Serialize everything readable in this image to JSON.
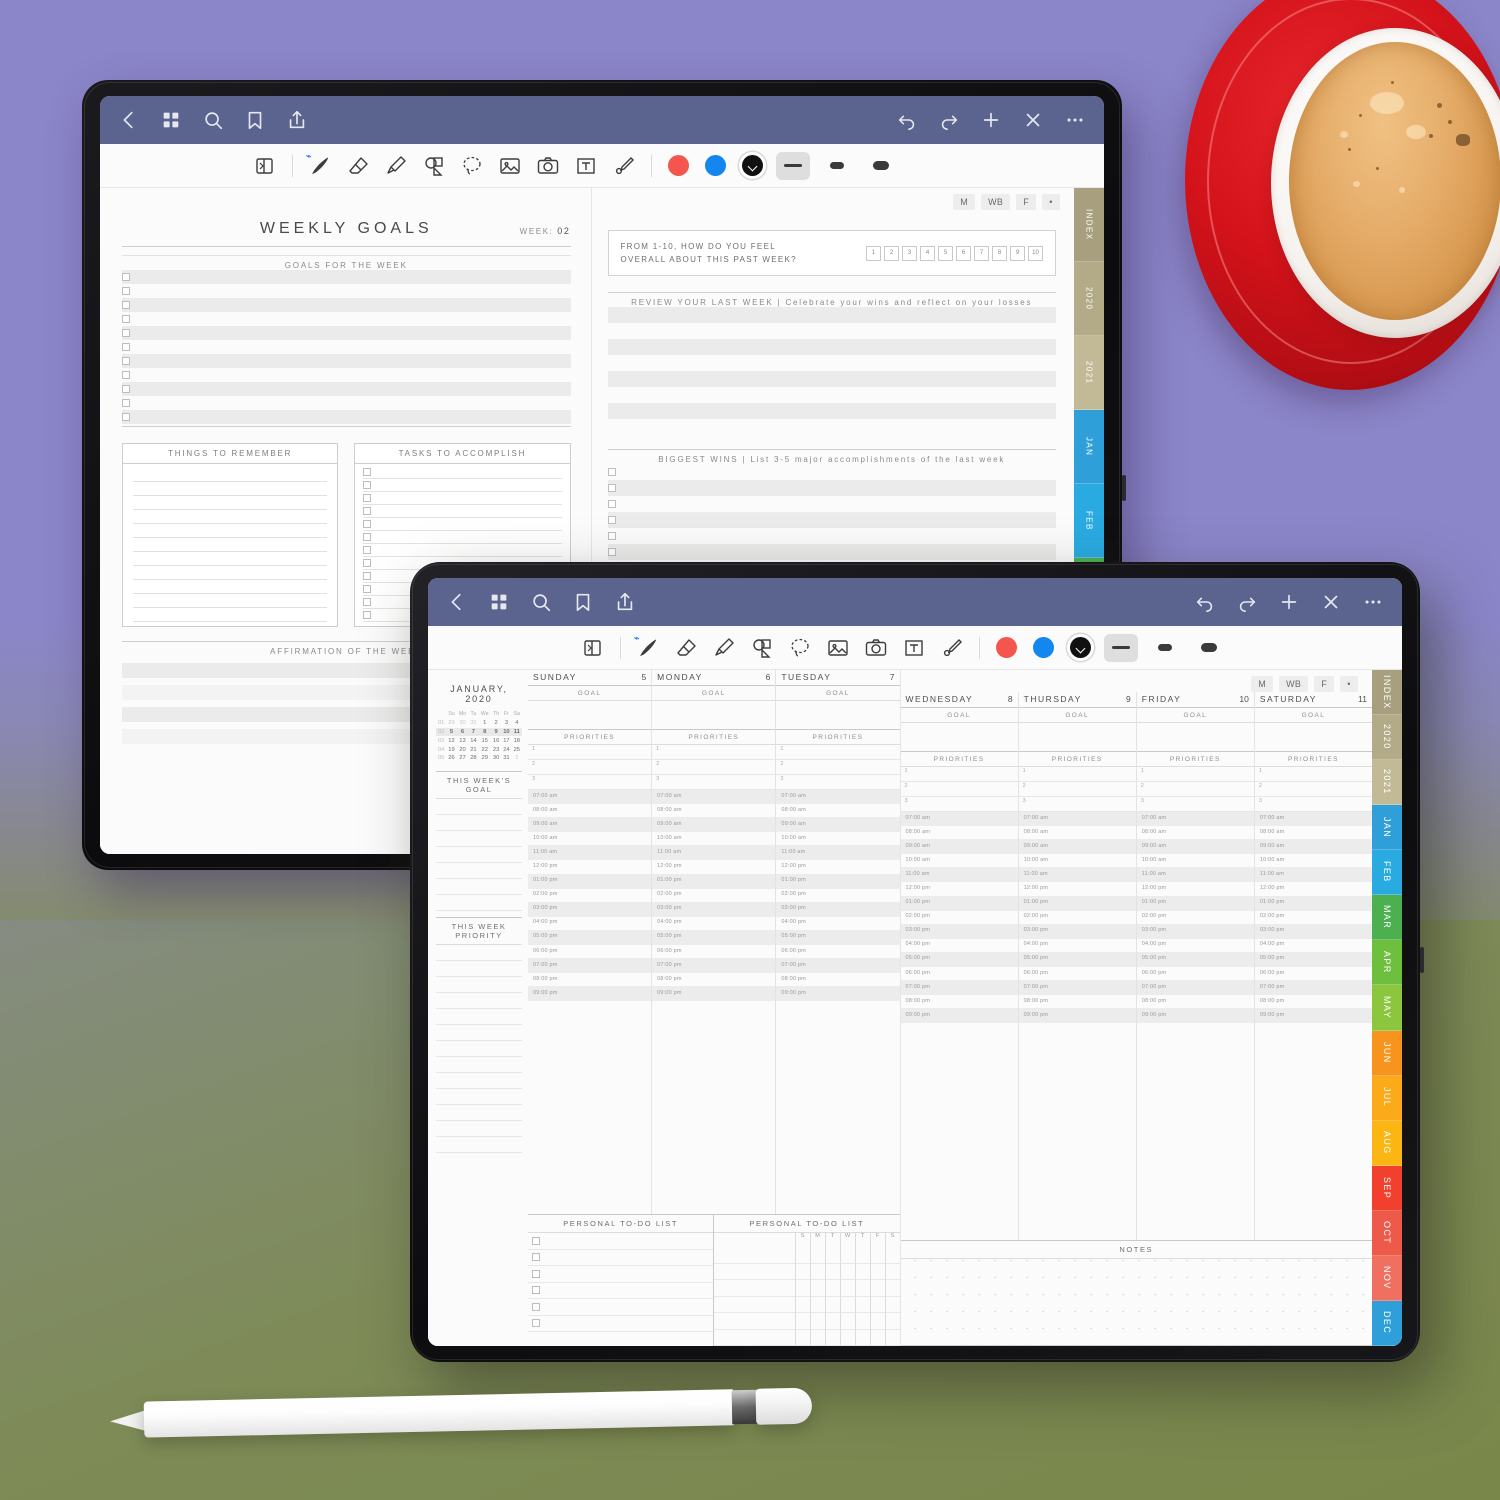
{
  "app": {
    "nav_left_icons": [
      "back-chevron-icon",
      "grid-thumbnails-icon",
      "search-icon",
      "bookmark-icon",
      "share-icon"
    ],
    "nav_right_icons": [
      "undo-icon",
      "redo-icon",
      "add-page-icon",
      "close-icon",
      "more-options-icon"
    ],
    "toolbar_tools": [
      "page-flip-icon",
      "pen-icon",
      "eraser-icon",
      "highlighter-icon",
      "shapes-icon",
      "lasso-select-icon",
      "image-icon",
      "camera-icon",
      "text-box-icon",
      "sticker-icon"
    ],
    "active_tool": "pen-icon",
    "bluetooth_indicator": true,
    "colors": [
      {
        "name": "red-swatch",
        "hex": "#f4564e",
        "selected": false
      },
      {
        "name": "blue-swatch",
        "hex": "#1486f0",
        "selected": false
      },
      {
        "name": "black-swatch",
        "hex": "#111111",
        "selected": true
      }
    ],
    "stroke_widths": [
      {
        "name": "thin-stroke",
        "selected": true
      },
      {
        "name": "medium-stroke",
        "selected": false
      },
      {
        "name": "thick-stroke",
        "selected": false
      }
    ],
    "navbar_color": "#5a648e"
  },
  "mode_chips": [
    "M",
    "WB",
    "F",
    "•"
  ],
  "side_tabs": [
    {
      "label": "INDEX",
      "color": "#a79f7e"
    },
    {
      "label": "2020",
      "color": "#b3ab87"
    },
    {
      "label": "2021",
      "color": "#c2ba96"
    },
    {
      "label": "JAN",
      "color": "#2e9fd8"
    },
    {
      "label": "FEB",
      "color": "#29abe2"
    },
    {
      "label": "MAR",
      "color": "#4caf50"
    },
    {
      "label": "APR",
      "color": "#6fbf3f"
    },
    {
      "label": "MAY",
      "color": "#8cc63f"
    },
    {
      "label": "JUN",
      "color": "#f7941e"
    },
    {
      "label": "JUL",
      "color": "#fbaa19"
    },
    {
      "label": "AUG",
      "color": "#fbb614"
    },
    {
      "label": "SEP",
      "color": "#f1412e"
    },
    {
      "label": "OCT",
      "color": "#ee5a49"
    },
    {
      "label": "NOV",
      "color": "#ef7060"
    },
    {
      "label": "DEC",
      "color": "#2e9fd8"
    }
  ],
  "weekly_goals_page": {
    "title": "WEEKLY GOALS",
    "week_label": "WEEK:",
    "week_value": "02",
    "goals_section": "GOALS FOR THE WEEK",
    "goal_rows": 11,
    "things_to_remember": "THINGS TO REMEMBER",
    "things_lines": 11,
    "tasks_to_accomplish": "TASKS TO ACCOMPLISH",
    "task_rows": 12,
    "affirmation": "AFFIRMATION OF THE WEEK"
  },
  "weekly_review_page": {
    "rating_question_line1": "FROM 1-10, HOW DO YOU FEEL",
    "rating_question_line2": "OVERALL ABOUT THIS PAST WEEK?",
    "rating_scale": [
      "1",
      "2",
      "3",
      "4",
      "5",
      "6",
      "7",
      "8",
      "9",
      "10"
    ],
    "review_header": "REVIEW YOUR LAST WEEK | Celebrate your wins and reflect on your losses",
    "review_rows": 8,
    "wins_header": "BIGGEST WINS | List 3-5 major accomplishments of the last week",
    "wins_rows": 6
  },
  "weekly_planner_page": {
    "month_title": "JANUARY, 2020",
    "calendar": {
      "weekday_headers": [
        "Su",
        "Mo",
        "Tu",
        "We",
        "Th",
        "Fr",
        "Sa"
      ],
      "weeks": [
        {
          "num": "01",
          "days": [
            "29",
            "30",
            "31",
            "1",
            "2",
            "3",
            "4"
          ],
          "outside": [
            true,
            true,
            true,
            false,
            false,
            false,
            false
          ],
          "current": false
        },
        {
          "num": "02",
          "days": [
            "5",
            "6",
            "7",
            "8",
            "9",
            "10",
            "11"
          ],
          "outside": [
            false,
            false,
            false,
            false,
            false,
            false,
            false
          ],
          "current": true
        },
        {
          "num": "03",
          "days": [
            "12",
            "13",
            "14",
            "15",
            "16",
            "17",
            "18"
          ],
          "outside": [
            false,
            false,
            false,
            false,
            false,
            false,
            false
          ],
          "current": false
        },
        {
          "num": "04",
          "days": [
            "19",
            "20",
            "21",
            "22",
            "23",
            "24",
            "25"
          ],
          "outside": [
            false,
            false,
            false,
            false,
            false,
            false,
            false
          ],
          "current": false
        },
        {
          "num": "05",
          "days": [
            "26",
            "27",
            "28",
            "29",
            "30",
            "31",
            "1"
          ],
          "outside": [
            false,
            false,
            false,
            false,
            false,
            false,
            true
          ],
          "current": false
        }
      ]
    },
    "this_weeks_goal": "THIS WEEK'S GOAL",
    "this_week_priority": "THIS WEEK PRIORITY",
    "goal_lines": 7,
    "priority_lines": 13,
    "day_column_goal_label": "GOAL",
    "day_column_priorities_label": "PRIORITIES",
    "priority_numbers": [
      "1",
      "2",
      "3"
    ],
    "days": [
      {
        "name": "SUNDAY",
        "num": "5"
      },
      {
        "name": "MONDAY",
        "num": "6"
      },
      {
        "name": "TUESDAY",
        "num": "7"
      },
      {
        "name": "WEDNESDAY",
        "num": "8"
      },
      {
        "name": "THURSDAY",
        "num": "9"
      },
      {
        "name": "FRIDAY",
        "num": "10"
      },
      {
        "name": "SATURDAY",
        "num": "11"
      }
    ],
    "time_slots": [
      "07:00 am",
      "08:00 am",
      "09:00 am",
      "10:00 am",
      "11:00 am",
      "12:00 pm",
      "01:00 pm",
      "02:00 pm",
      "03:00 pm",
      "04:00 pm",
      "05:00 pm",
      "06:00 pm",
      "07:00 pm",
      "08:00 pm",
      "09:00 pm"
    ],
    "personal_todo_label": "PERSONAL TO-DO LIST",
    "todo_rows": 6,
    "habit_days": [
      "S",
      "M",
      "T",
      "W",
      "T",
      "F",
      "S"
    ],
    "notes_label": "NOTES"
  },
  "scene": {
    "background_top_color": "#8b86c9",
    "background_bottom_color": "#7d8a4f",
    "saucer_color": "#d3121a",
    "coffee_color": "#e6ad6a",
    "pencil_color": "#ffffff"
  }
}
